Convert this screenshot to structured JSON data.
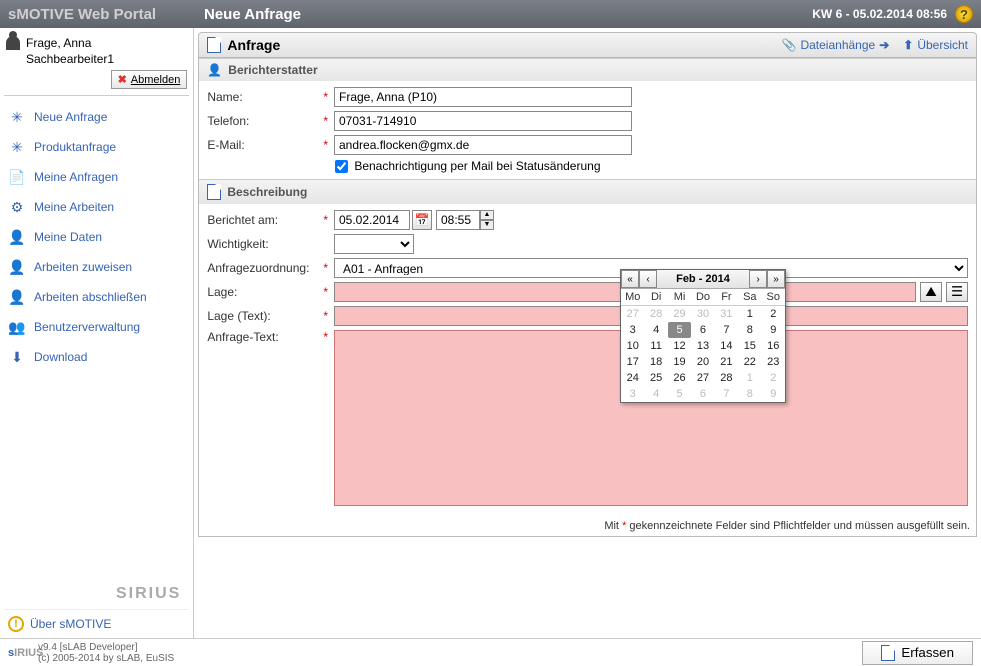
{
  "header": {
    "app_title": "sMOTIVE Web Portal",
    "page_title": "Neue Anfrage",
    "datetime": "KW 6 - 05.02.2014 08:56"
  },
  "user": {
    "name": "Frage, Anna",
    "role": "Sachbearbeiter1",
    "logout": "Abmelden"
  },
  "nav": [
    {
      "label": "Neue Anfrage",
      "icon": "new-request-icon"
    },
    {
      "label": "Produktanfrage",
      "icon": "product-request-icon"
    },
    {
      "label": "Meine Anfragen",
      "icon": "my-requests-icon"
    },
    {
      "label": "Meine Arbeiten",
      "icon": "my-work-icon"
    },
    {
      "label": "Meine Daten",
      "icon": "my-data-icon"
    },
    {
      "label": "Arbeiten zuweisen",
      "icon": "assign-work-icon"
    },
    {
      "label": "Arbeiten abschließen",
      "icon": "finish-work-icon"
    },
    {
      "label": "Benutzerverwaltung",
      "icon": "user-admin-icon"
    },
    {
      "label": "Download",
      "icon": "download-icon"
    }
  ],
  "about": "Über sMOTIVE",
  "sirius": "SIRIUS",
  "panel": {
    "title": "Anfrage",
    "attachments": "Dateianhänge",
    "overview": "Übersicht"
  },
  "reporter": {
    "section": "Berichterstatter",
    "name_label": "Name:",
    "name_value": "Frage, Anna (P10)",
    "phone_label": "Telefon:",
    "phone_value": "07031-714910",
    "email_label": "E-Mail:",
    "email_value": "andrea.flocken@gmx.de",
    "notify_label": "Benachrichtigung per Mail bei Statusänderung",
    "notify_checked": true
  },
  "desc": {
    "section": "Beschreibung",
    "reported_label": "Berichtet am:",
    "reported_date": "05.02.2014",
    "reported_time": "08:55",
    "importance_label": "Wichtigkeit:",
    "importance_value": "",
    "assignment_label": "Anfragezuordnung:",
    "assignment_value": "A01 - Anfragen",
    "lage_label": "Lage:",
    "lage_value": "",
    "lage_text_label": "Lage (Text):",
    "lage_text_value": "",
    "request_text_label": "Anfrage-Text:",
    "request_text_value": ""
  },
  "hint_prefix": "Mit ",
  "hint_suffix": " gekennzeichnete Felder sind Pflichtfelder und müssen ausgefüllt sein.",
  "footer": {
    "version": "v9.4 [sLAB Developer]",
    "copyright": "(c) 2005-2014 by sLAB, EuSIS",
    "submit": "Erfassen"
  },
  "datepicker": {
    "title": "Feb - 2014",
    "dow": [
      "Mo",
      "Di",
      "Mi",
      "Do",
      "Fr",
      "Sa",
      "So"
    ],
    "weeks": [
      [
        {
          "d": 27,
          "o": 1
        },
        {
          "d": 28,
          "o": 1
        },
        {
          "d": 29,
          "o": 1
        },
        {
          "d": 30,
          "o": 1
        },
        {
          "d": 31,
          "o": 1
        },
        {
          "d": 1
        },
        {
          "d": 2
        }
      ],
      [
        {
          "d": 3
        },
        {
          "d": 4
        },
        {
          "d": 5,
          "sel": 1
        },
        {
          "d": 6
        },
        {
          "d": 7
        },
        {
          "d": 8
        },
        {
          "d": 9
        }
      ],
      [
        {
          "d": 10
        },
        {
          "d": 11
        },
        {
          "d": 12
        },
        {
          "d": 13
        },
        {
          "d": 14
        },
        {
          "d": 15
        },
        {
          "d": 16
        }
      ],
      [
        {
          "d": 17
        },
        {
          "d": 18
        },
        {
          "d": 19
        },
        {
          "d": 20
        },
        {
          "d": 21
        },
        {
          "d": 22
        },
        {
          "d": 23
        }
      ],
      [
        {
          "d": 24
        },
        {
          "d": 25
        },
        {
          "d": 26
        },
        {
          "d": 27
        },
        {
          "d": 28
        },
        {
          "d": 1,
          "o": 1
        },
        {
          "d": 2,
          "o": 1
        }
      ],
      [
        {
          "d": 3,
          "o": 1
        },
        {
          "d": 4,
          "o": 1
        },
        {
          "d": 5,
          "o": 1
        },
        {
          "d": 6,
          "o": 1
        },
        {
          "d": 7,
          "o": 1
        },
        {
          "d": 8,
          "o": 1
        },
        {
          "d": 9,
          "o": 1
        }
      ]
    ]
  }
}
